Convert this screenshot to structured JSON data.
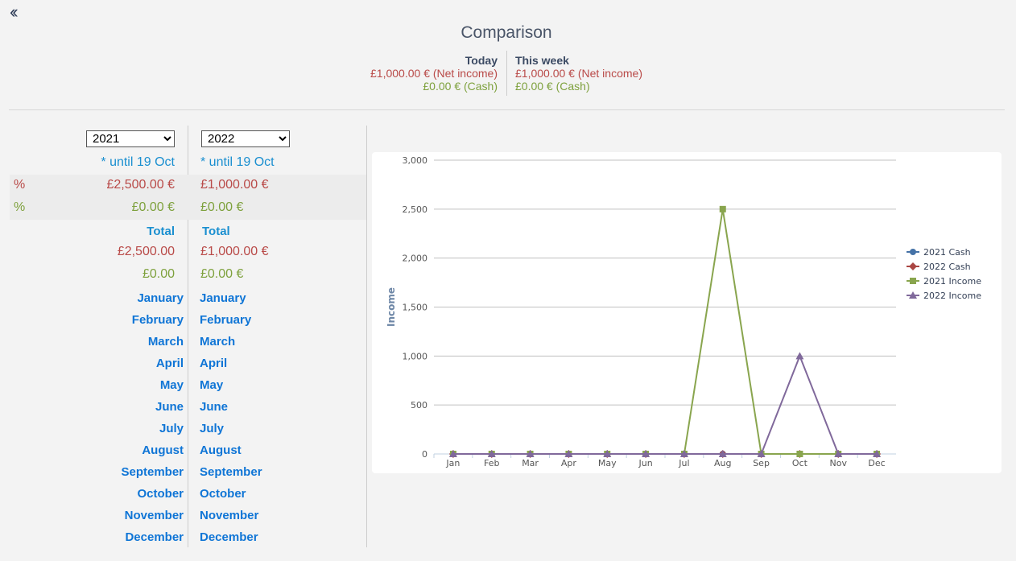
{
  "nav": {
    "back_icon": "double-chevron-left-icon"
  },
  "header": {
    "title": "Comparison",
    "today": {
      "label": "Today",
      "net": "£1,000.00 € (Net income)",
      "cash": "£0.00 € (Cash)"
    },
    "week": {
      "label": "This week",
      "net": "£1,000.00 € (Net income)",
      "cash": "£0.00 € (Cash)"
    }
  },
  "left": {
    "year": "2021",
    "years": [
      "2021",
      "2022"
    ],
    "until": "* until 19 Oct",
    "pct1": "%",
    "pct2": "%",
    "net": "£2,500.00 €",
    "cash": "£0.00 €",
    "total_label": "Total",
    "total_net": "£2,500.00",
    "total_cash": "£0.00"
  },
  "right": {
    "year": "2022",
    "years": [
      "2021",
      "2022"
    ],
    "until": "* until 19 Oct",
    "net": "£1,000.00 €",
    "cash": "£0.00 €",
    "total_label": "Total",
    "total_net": "£1,000.00 €",
    "total_cash": "£0.00 €"
  },
  "months": [
    "January",
    "February",
    "March",
    "April",
    "May",
    "June",
    "July",
    "August",
    "September",
    "October",
    "November",
    "December"
  ],
  "colors": {
    "net": "#b94a48",
    "cash": "#7ea13d",
    "link": "#0f75d6"
  },
  "chart_data": {
    "type": "line",
    "categories": [
      "Jan",
      "Feb",
      "Mar",
      "Apr",
      "May",
      "Jun",
      "Jul",
      "Aug",
      "Sep",
      "Oct",
      "Nov",
      "Dec"
    ],
    "ylabel": "Income",
    "ylim": [
      0,
      3000
    ],
    "yticks": [
      0,
      500,
      1000,
      1500,
      2000,
      2500,
      3000
    ],
    "grid": true,
    "legend": "right",
    "series": [
      {
        "name": "2021 Cash",
        "color": "#4572a7",
        "marker": "circle",
        "values": [
          0,
          0,
          0,
          0,
          0,
          0,
          0,
          0,
          0,
          0,
          0,
          0
        ]
      },
      {
        "name": "2022 Cash",
        "color": "#aa4643",
        "marker": "diamond",
        "values": [
          0,
          0,
          0,
          0,
          0,
          0,
          0,
          0,
          0,
          0,
          0,
          0
        ]
      },
      {
        "name": "2021 Income",
        "color": "#89a54e",
        "marker": "square",
        "values": [
          0,
          0,
          0,
          0,
          0,
          0,
          0,
          2500,
          0,
          0,
          0,
          0
        ]
      },
      {
        "name": "2022 Income",
        "color": "#80699b",
        "marker": "triangle",
        "values": [
          0,
          0,
          0,
          0,
          0,
          0,
          0,
          0,
          0,
          1000,
          0,
          0
        ]
      }
    ]
  }
}
